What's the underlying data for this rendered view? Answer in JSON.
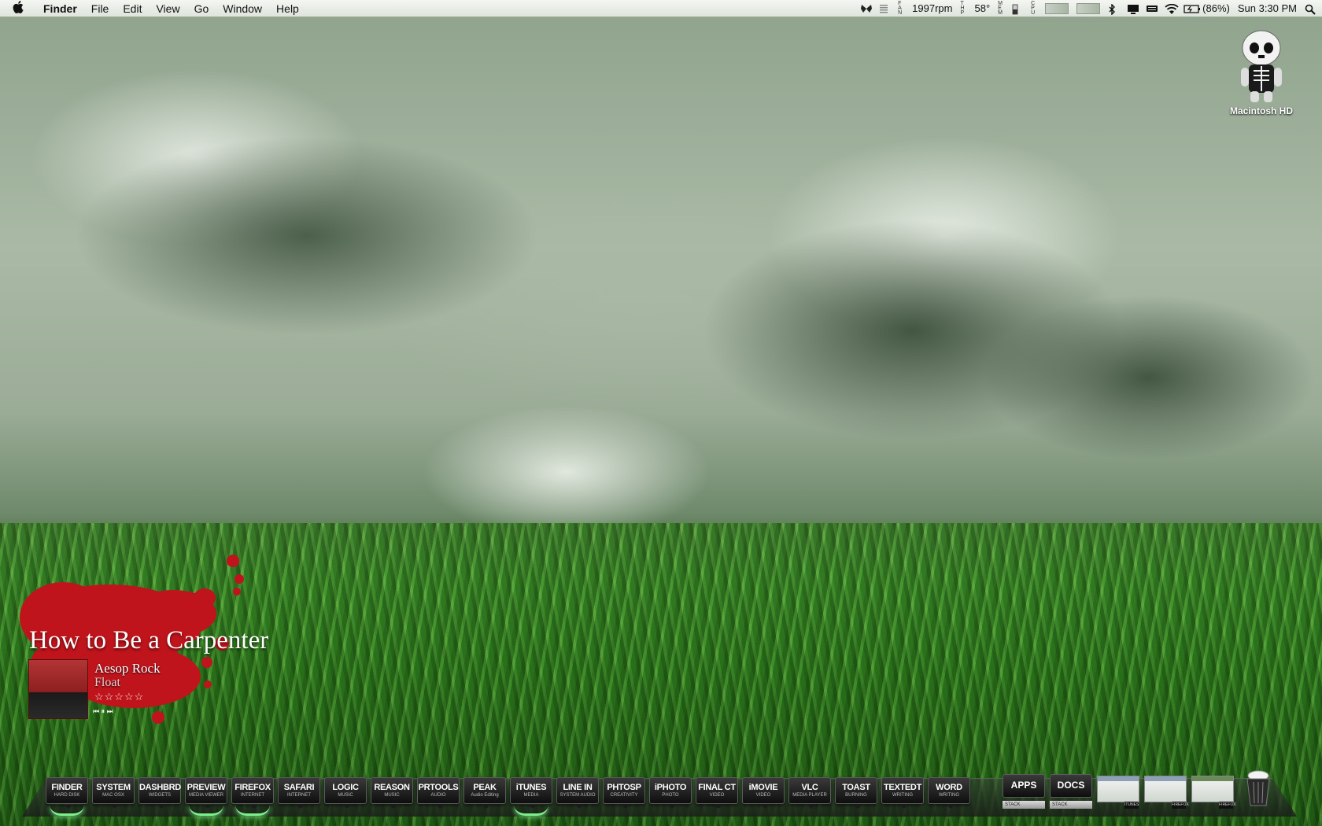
{
  "menubar": {
    "app": "Finder",
    "menus": [
      "File",
      "Edit",
      "View",
      "Go",
      "Window",
      "Help"
    ],
    "status": {
      "fan_label": "F A N",
      "fan": "1997rpm",
      "temp_label": "T H P",
      "temp": "58°",
      "mem_label": "M E M",
      "cpu_label": "C P U",
      "battery": "(86%)",
      "clock": "Sun 3:30 PM"
    }
  },
  "desktop": {
    "drive_label": "Macintosh HD"
  },
  "now_playing": {
    "title": "How to Be a Carpenter",
    "artist": "Aesop Rock",
    "album": "Float",
    "rating": "☆☆☆☆☆",
    "controls": "⏮ ⏸ ⏭"
  },
  "dock": {
    "items": [
      {
        "name": "FINDER",
        "sub": "HARD DISK",
        "running": true
      },
      {
        "name": "SYSTEM",
        "sub": "MAC OSX",
        "running": false
      },
      {
        "name": "DASHBRD",
        "sub": "WIDGETS",
        "running": false
      },
      {
        "name": "PREVIEW",
        "sub": "MEDIA VIEWER",
        "running": true
      },
      {
        "name": "FIREFOX",
        "sub": "INTERNET",
        "running": true
      },
      {
        "name": "SAFARI",
        "sub": "INTERNET",
        "running": false
      },
      {
        "name": "LOGIC",
        "sub": "MUSIC",
        "running": false
      },
      {
        "name": "REASON",
        "sub": "MUSIC",
        "running": false
      },
      {
        "name": "PRTOOLS",
        "sub": "AUDIO",
        "running": false
      },
      {
        "name": "PEAK",
        "sub": "Audio Editing",
        "running": false
      },
      {
        "name": "iTUNES",
        "sub": "MEDIA",
        "running": true
      },
      {
        "name": "LINE IN",
        "sub": "SYSTEM AUDIO",
        "running": false
      },
      {
        "name": "PHTOSP",
        "sub": "CREATIVITY",
        "running": false
      },
      {
        "name": "iPHOTO",
        "sub": "PHOTO",
        "running": false
      },
      {
        "name": "FINAL CT",
        "sub": "VIDEO",
        "running": false
      },
      {
        "name": "iMOVIE",
        "sub": "VIDEO",
        "running": false
      },
      {
        "name": "VLC",
        "sub": "MEDIA PLAYER",
        "running": false
      },
      {
        "name": "TOAST",
        "sub": "BURNING",
        "running": false
      },
      {
        "name": "TEXTEDT",
        "sub": "WRITING",
        "running": false
      },
      {
        "name": "WORD",
        "sub": "WRITING",
        "running": false
      }
    ],
    "stacks": [
      {
        "name": "APPS",
        "sub": "STACK"
      },
      {
        "name": "DOCS",
        "sub": "STACK"
      }
    ],
    "minimized": [
      {
        "tag": "ITUNES"
      },
      {
        "tag": "FIREFOX"
      },
      {
        "tag": "FIREFOX"
      }
    ]
  },
  "colors": {
    "accent_running": "#7cf08a",
    "splat": "#c0141c"
  }
}
